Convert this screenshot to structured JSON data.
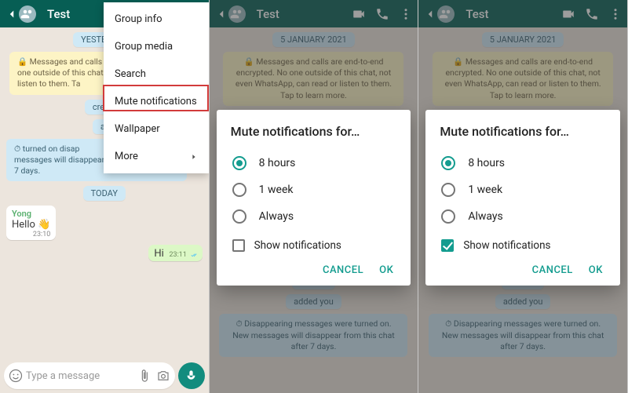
{
  "header": {
    "title": "Test",
    "icon_video": "video-icon",
    "icon_call": "phone-icon",
    "icon_more": "more-vert-icon"
  },
  "menu": {
    "items": [
      {
        "label": "Group info"
      },
      {
        "label": "Group media"
      },
      {
        "label": "Search"
      },
      {
        "label": "Mute notifications"
      },
      {
        "label": "Wallpaper"
      },
      {
        "label": "More"
      }
    ]
  },
  "p1": {
    "date1": "YESTERDAY",
    "encrypt": "Messages and calls are end-to-end encrypted. No one outside of this chat, not even WhatsApp, can read or listen to them. Tap to learn more.",
    "encrypt_cut": "🔒 Messages and calls are\none outside of this chat, not e\nlisten to them. Ta",
    "created_cut": "create",
    "added_cut": "ac",
    "disappear_cut": "⏱  turned on disap\nmessages will disappear from this chat after 7 days.",
    "date2": "TODAY",
    "sender": "Yong",
    "in_text": "Hello 👋",
    "in_time": "23:10",
    "out_text": "Hi",
    "out_time": "23:11",
    "input_placeholder": "Type a message"
  },
  "p23": {
    "date1": "5 JANUARY 2021",
    "encrypt": "🔒 Messages and calls are end-to-end encrypted. No one outside of this chat, not even WhatsApp, can read or listen to them. Tap to learn more.",
    "created": "created group \"Test\"",
    "added": "added you",
    "disappear": "⏱ Disappearing messages were turned on. New messages will disappear from this chat after 7 days.",
    "date2": "TODAY"
  },
  "dialog": {
    "title": "Mute notifications for…",
    "opt1": "8 hours",
    "opt2": "1 week",
    "opt3": "Always",
    "show_label": "Show notifications",
    "cancel": "CANCEL",
    "ok": "OK"
  }
}
